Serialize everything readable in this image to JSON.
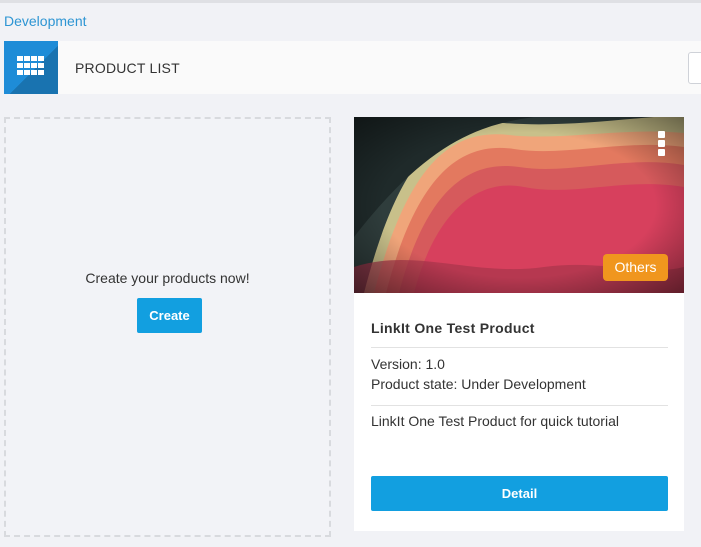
{
  "breadcrumb": {
    "label": "Development"
  },
  "header": {
    "icon": "grid-icon",
    "title": "PRODUCT LIST"
  },
  "create_card": {
    "prompt": "Create your products now!",
    "button_label": "Create"
  },
  "product": {
    "category": "Others",
    "name": "LinkIt One Test Product",
    "version": "Version: 1.0",
    "state": "Product state: Under Development",
    "description": "LinkIt One Test Product for quick tutorial",
    "detail_label": "Detail",
    "menu_icon": "kebab-menu-icon"
  },
  "colors": {
    "accent": "#129fe0",
    "link": "#2d95d3",
    "badge": "#f0961e",
    "header_icon_bg": "#1e8cd7"
  }
}
